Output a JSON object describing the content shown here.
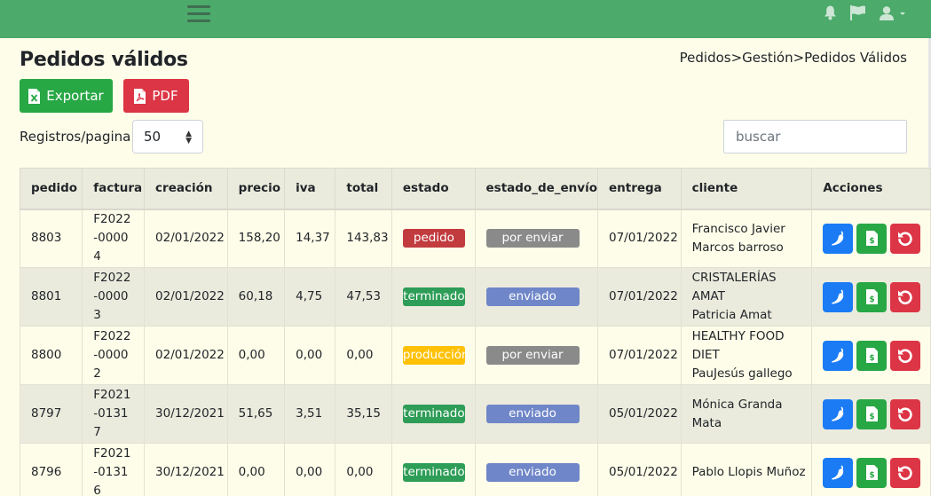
{
  "page": {
    "title": "Pedidos válidos",
    "breadcrumb": "Pedidos>Gestión>Pedidos Válidos"
  },
  "toolbar": {
    "export_label": "Exportar",
    "pdf_label": "PDF",
    "registros_label": "Registros/pagina:",
    "registros_value": "50",
    "search_placeholder": "buscar"
  },
  "table": {
    "columns": [
      "pedido",
      "factura",
      "creación",
      "precio",
      "iva",
      "total",
      "estado",
      "estado_de_envío",
      "entrega",
      "cliente",
      "Acciones"
    ],
    "rows": [
      {
        "pedido": "8803",
        "factura": "F2022-00004",
        "creacion": "02/01/2022",
        "precio": "158,20",
        "iva": "14,37",
        "total": "143,83",
        "estado": "pedido",
        "estado_color": "#c23b3f",
        "envio": "por enviar",
        "envio_color": "#8a8a8a",
        "entrega": "07/01/2022",
        "cliente1": "Francisco Javier",
        "cliente2": "Marcos barroso"
      },
      {
        "pedido": "8801",
        "factura": "F2022-00003",
        "creacion": "02/01/2022",
        "precio": "60,18",
        "iva": "4,75",
        "total": "47,53",
        "estado": "terminado",
        "estado_color": "#2e9d57",
        "envio": "enviado",
        "envio_color": "#6f86c8",
        "entrega": "07/01/2022",
        "cliente1": "CRISTALERÍAS AMAT",
        "cliente2": "Patricia Amat"
      },
      {
        "pedido": "8800",
        "factura": "F2022-00002",
        "creacion": "02/01/2022",
        "precio": "0,00",
        "iva": "0,00",
        "total": "0,00",
        "estado": "producción",
        "estado_color": "#ffc107",
        "envio": "por enviar",
        "envio_color": "#8a8a8a",
        "entrega": "07/01/2022",
        "cliente1": "HEALTHY FOOD DIET",
        "cliente2": "PauJesús gallego"
      },
      {
        "pedido": "8797",
        "factura": "F2021-01317",
        "creacion": "30/12/2021",
        "precio": "51,65",
        "iva": "3,51",
        "total": "35,15",
        "estado": "terminado",
        "estado_color": "#2e9d57",
        "envio": "enviado",
        "envio_color": "#6f86c8",
        "entrega": "05/01/2022",
        "cliente1": "Mónica Granda Mata",
        "cliente2": ""
      },
      {
        "pedido": "8796",
        "factura": "F2021-01316",
        "creacion": "30/12/2021",
        "precio": "0,00",
        "iva": "0,00",
        "total": "0,00",
        "estado": "terminado",
        "estado_color": "#2e9d57",
        "envio": "enviado",
        "envio_color": "#6f86c8",
        "entrega": "05/01/2022",
        "cliente1": "Pablo Llopis Muñoz",
        "cliente2": ""
      }
    ]
  },
  "icons": {
    "menu": "hamburger-icon",
    "bell": "bell-icon",
    "flag": "flag-icon",
    "user": "user-icon",
    "export": "excel-file-icon",
    "pdf": "pdf-file-icon",
    "row_actions": [
      "chili-pepper-icon",
      "invoice-file-icon",
      "undo-icon"
    ]
  },
  "colors": {
    "topbar": "#4caa6b",
    "background": "#fefde9",
    "export": "#28a745",
    "pdf": "#dc3545"
  }
}
